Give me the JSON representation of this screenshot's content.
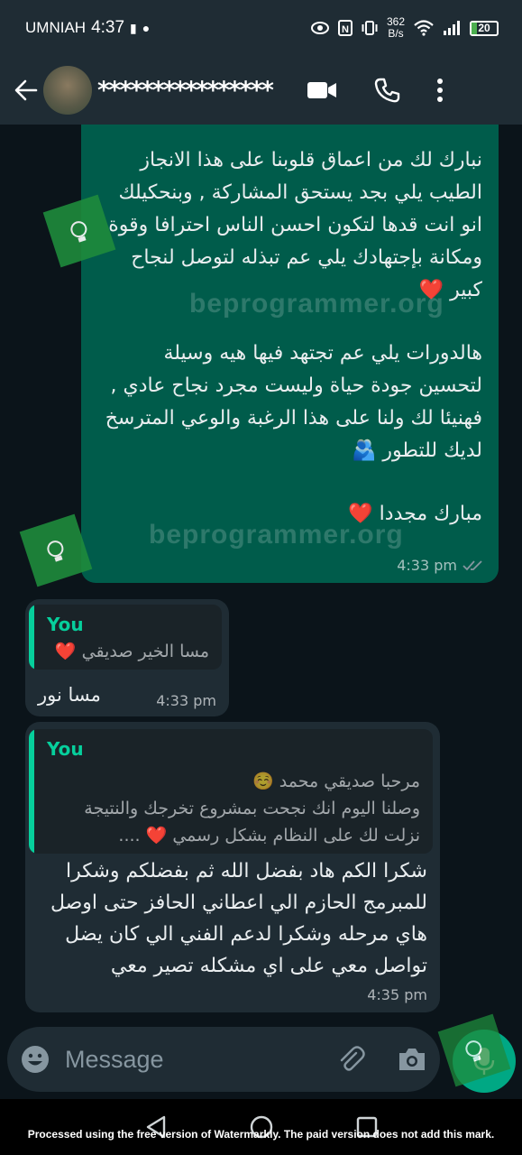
{
  "status_bar": {
    "carrier": "UMNIAH",
    "time": "4:37",
    "net_speed_value": "362",
    "net_speed_unit": "B/s",
    "battery": "20"
  },
  "header": {
    "contact_name": "****************"
  },
  "messages": {
    "outgoing_1": {
      "para1": "نبارك لك من اعماق قلوبنا على هذا الانجاز الطيب يلي بجد يستحق المشاركة , وبنحكيلك انو انت قدها لتكون احسن الناس احترافا وقوة ومكانة بإجتهادك يلي عم تبذله لتوصل لنجاح كبير",
      "para2": "هالدورات  يلي عم تجتهد فيها هيه وسيلة لتحسين جودة حياة وليست مجرد نجاح عادي , فهنيئا لك ولنا على هذا الرغبة والوعي المترسخ لديك للتطور",
      "para3": "مبارك مجددا",
      "time": "4:33 pm"
    },
    "incoming_1": {
      "quote_author": "You",
      "quote_text": "مسا الخير صديقي",
      "text": "مسا نور",
      "time": "4:33 pm"
    },
    "incoming_2": {
      "quote_author": "You",
      "quote_line1": "مرحبا صديقي محمد",
      "quote_line2": "وصلنا اليوم انك نجحت بمشروع تخرجك والنتيجة",
      "quote_line3": "نزلت لك على النظام بشكل رسمي",
      "text": "شكرا الكم هاد بفضل الله ثم بفضلكم وشكرا للمبرمج الحازم الي اعطاني الحافز حتى اوصل هاي مرحله وشكرا لدعم الفني الي كان يضل تواصل معي على اي مشكله تصير معي",
      "time": "4:35 pm"
    }
  },
  "input": {
    "placeholder": "Message"
  },
  "watermark": {
    "site": "beprogrammer.org",
    "notice": "Processed using the free version of Watermarkly. The paid version does not add this mark."
  },
  "colors": {
    "outgoing_bubble": "#005c4b",
    "incoming_bubble": "#1f2c34",
    "accent": "#06cf9c",
    "mic": "#00a884",
    "header": "#1f2c34",
    "background": "#0b141a"
  }
}
